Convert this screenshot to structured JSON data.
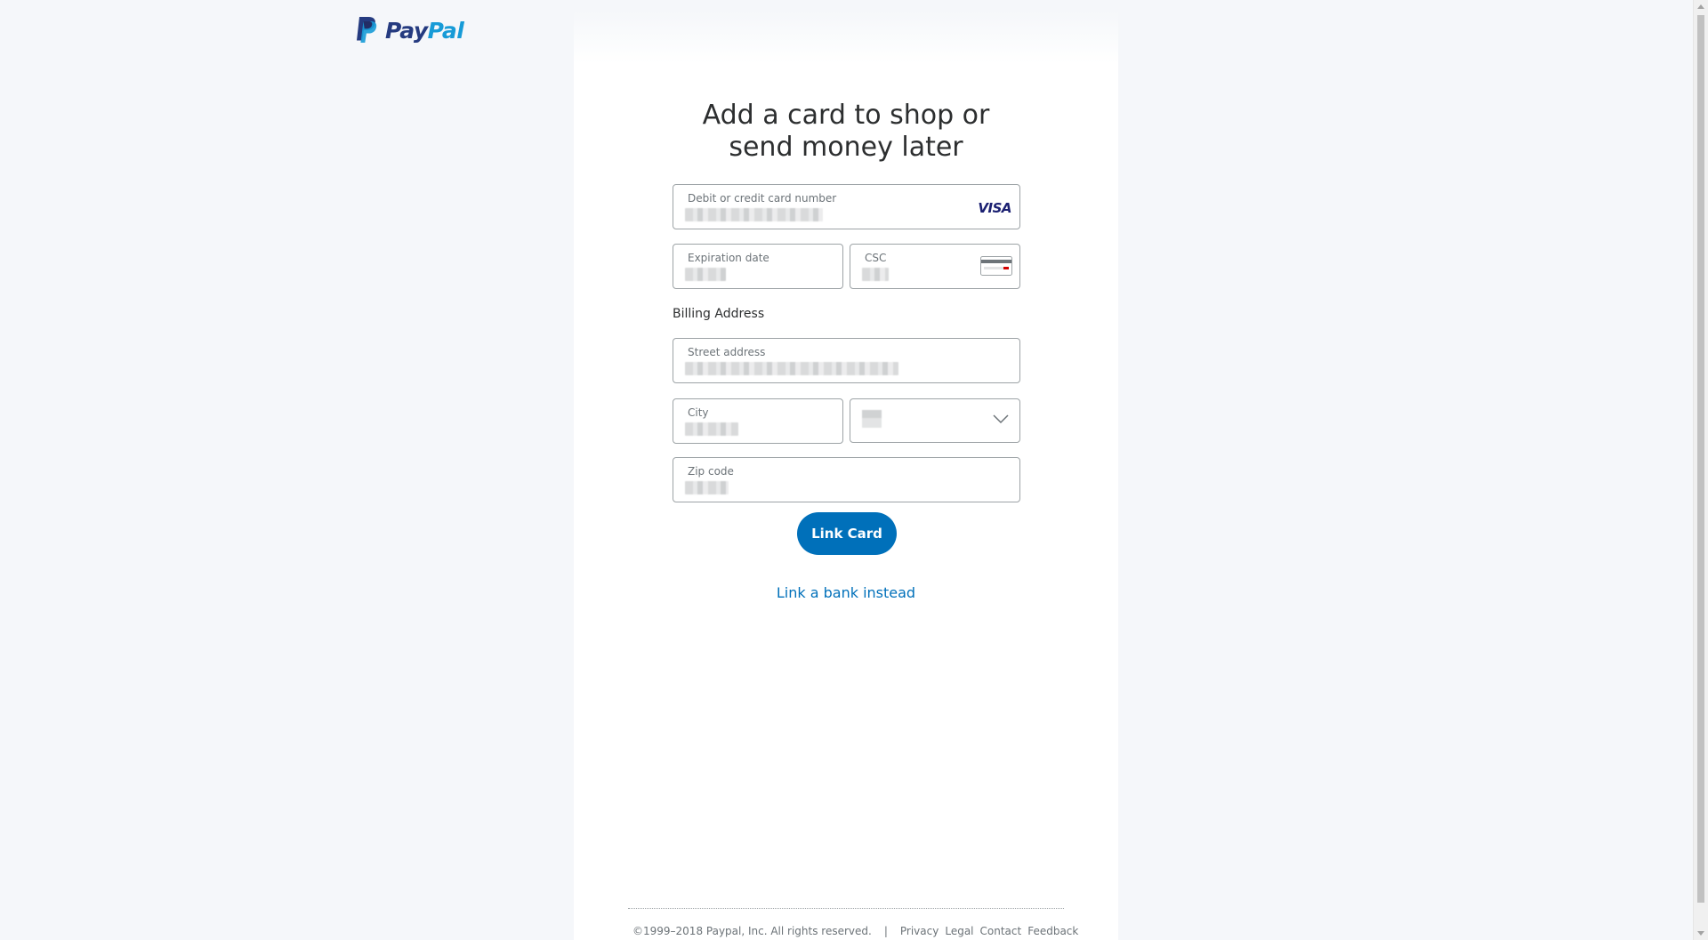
{
  "brand": {
    "logo_pay": "Pay",
    "logo_pal": "Pal",
    "colors": {
      "primary": "#0070ba",
      "logo_dark": "#253b80",
      "logo_light": "#179bd7"
    }
  },
  "form": {
    "title": "Add a card to shop or send money later",
    "card_number": {
      "label": "Debit or credit card number",
      "brand": "VISA",
      "value_obscured": true
    },
    "expiration": {
      "label": "Expiration date",
      "value_obscured": true
    },
    "csc": {
      "label": "CSC",
      "icon": "card-back-icon",
      "value_obscured": true
    },
    "billing_heading": "Billing Address",
    "street": {
      "label": "Street address",
      "value_obscured": true
    },
    "city": {
      "label": "City",
      "value_obscured": true
    },
    "state": {
      "icon": "chevron-down-icon",
      "value_obscured": true
    },
    "zip": {
      "label": "Zip code",
      "value_obscured": true
    },
    "submit_label": "Link Card",
    "alt_link": "Link a bank instead"
  },
  "footer": {
    "copyright": "©1999–2018 Paypal, Inc. All rights reserved.",
    "separator": "|",
    "links": [
      "Privacy",
      "Legal",
      "Contact",
      "Feedback"
    ]
  }
}
